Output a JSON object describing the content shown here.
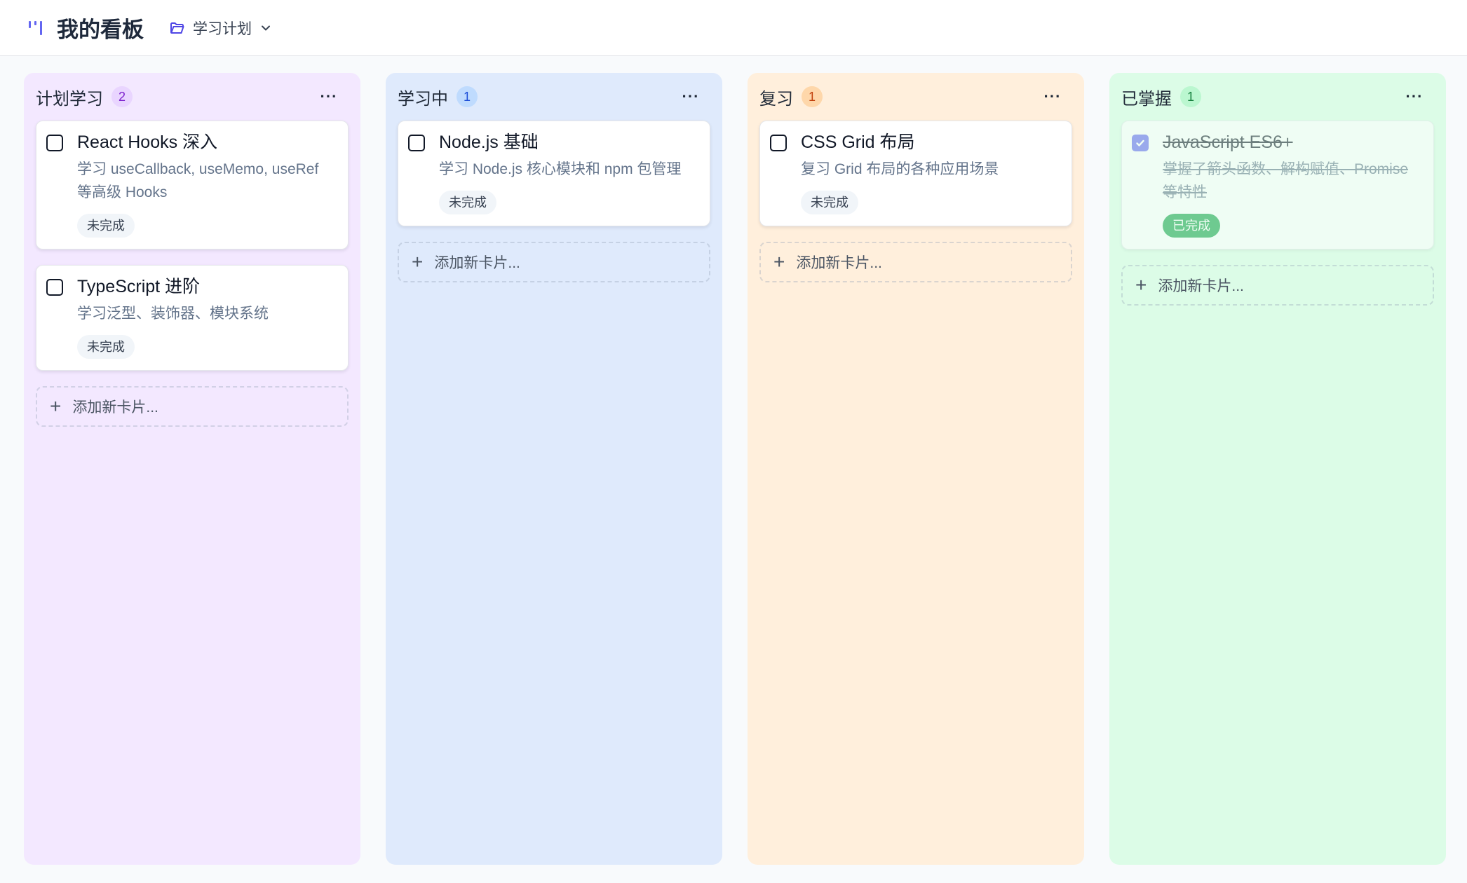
{
  "app": {
    "title": "我的看板",
    "board_name": "学习计划"
  },
  "colors": {
    "accent": "#6366f1"
  },
  "columns": [
    {
      "title": "计划学习",
      "count": "2",
      "more": "···",
      "bg": "#f3e8ff",
      "badge_bg": "#e9d5ff",
      "badge_fg": "#7e22ce",
      "add_label": "添加新卡片...",
      "cards": [
        {
          "title": "React Hooks 深入",
          "desc": "学习 useCallback, useMemo, useRef 等高级 Hooks",
          "status": "未完成",
          "done": false
        },
        {
          "title": "TypeScript 进阶",
          "desc": "学习泛型、装饰器、模块系统",
          "status": "未完成",
          "done": false
        }
      ]
    },
    {
      "title": "学习中",
      "count": "1",
      "more": "···",
      "bg": "#dfeafc",
      "badge_bg": "#bfdbfe",
      "badge_fg": "#1d4ed8",
      "add_label": "添加新卡片...",
      "cards": [
        {
          "title": "Node.js 基础",
          "desc": "学习 Node.js 核心模块和 npm 包管理",
          "status": "未完成",
          "done": false
        }
      ]
    },
    {
      "title": "复习",
      "count": "1",
      "more": "···",
      "bg": "#ffefdc",
      "badge_bg": "#fed7aa",
      "badge_fg": "#c2410c",
      "add_label": "添加新卡片...",
      "cards": [
        {
          "title": "CSS Grid 布局",
          "desc": "复习 Grid 布局的各种应用场景",
          "status": "未完成",
          "done": false
        }
      ]
    },
    {
      "title": "已掌握",
      "count": "1",
      "more": "···",
      "bg": "#dcfce7",
      "badge_bg": "#bbf7d0",
      "badge_fg": "#15803d",
      "add_label": "添加新卡片...",
      "cards": [
        {
          "title": "JavaScript ES6+",
          "desc": "掌握了箭头函数、解构赋值、Promise 等特性",
          "status": "已完成",
          "done": true
        }
      ]
    }
  ]
}
